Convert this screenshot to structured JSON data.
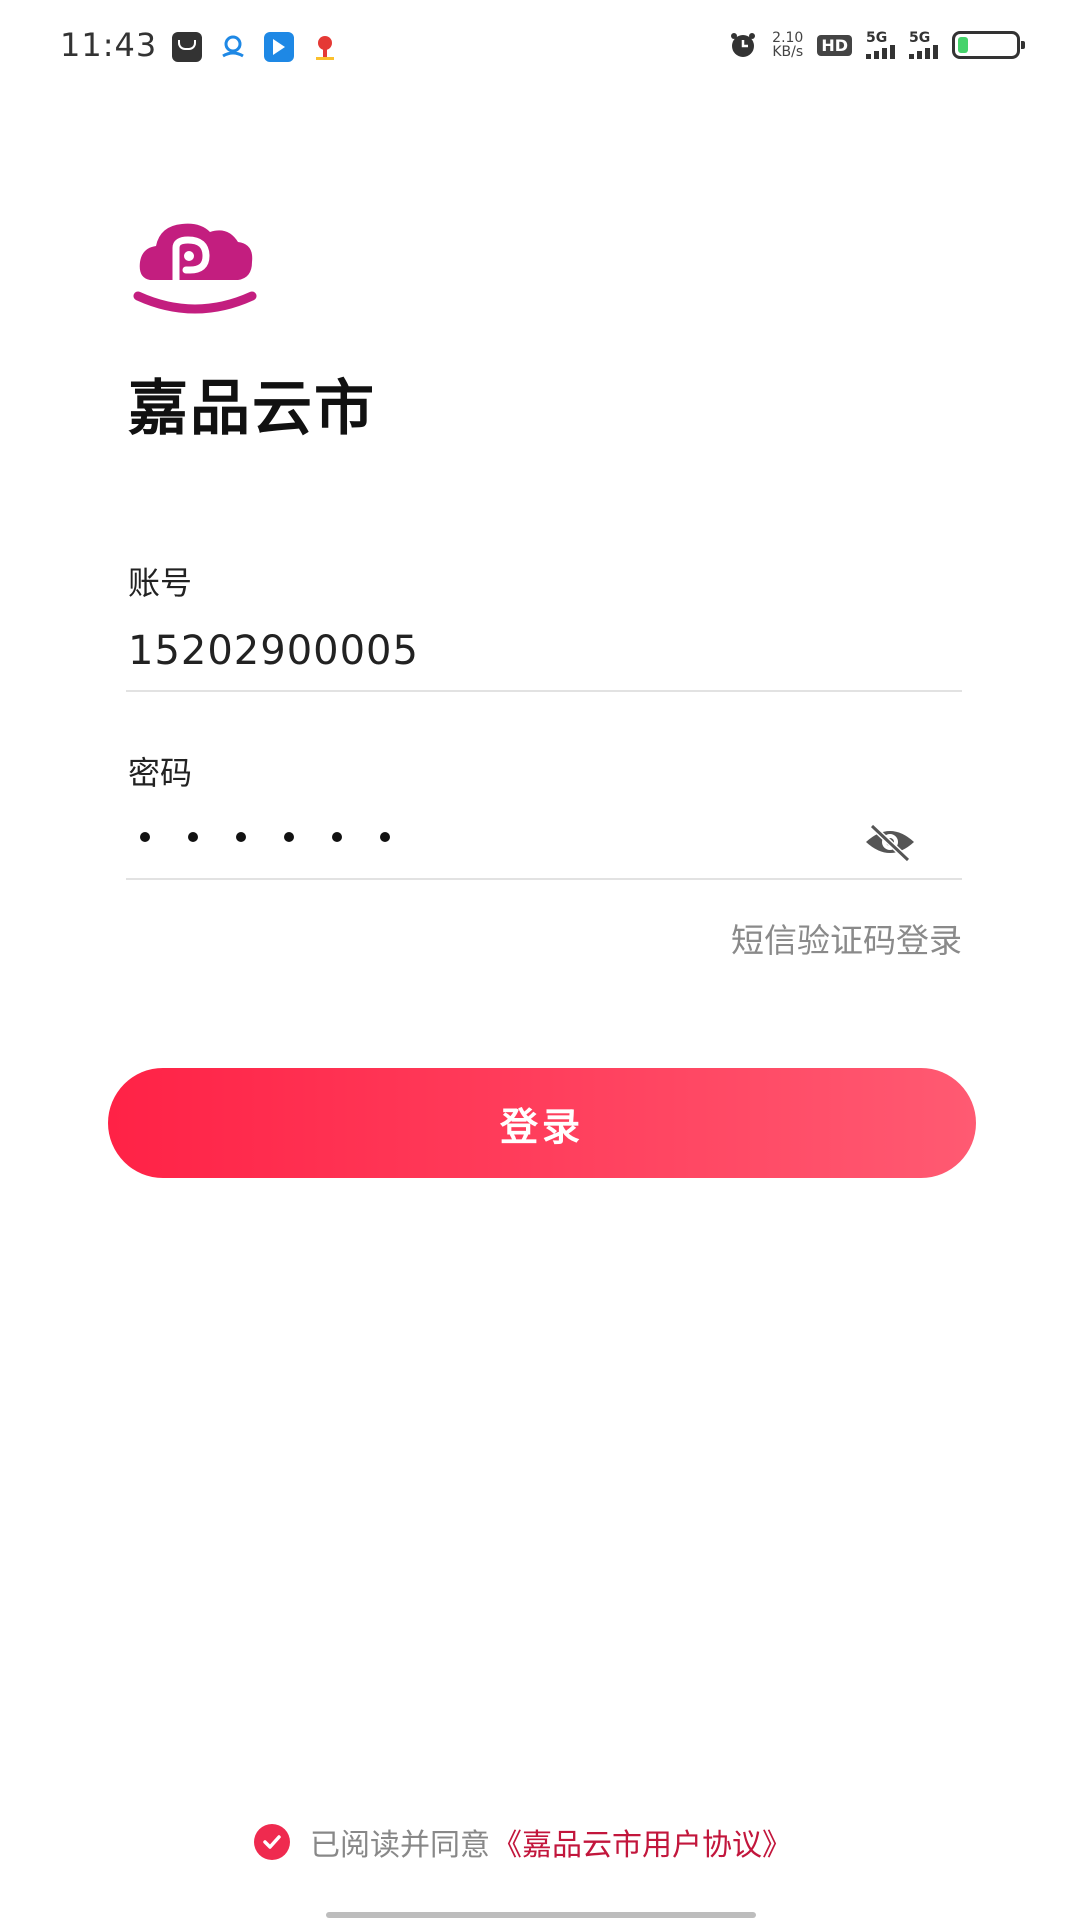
{
  "status_bar": {
    "time": "11:43",
    "net_speed_value": "2.10",
    "net_speed_unit": "KB/s",
    "hd_label": "HD",
    "sim1_label": "5G",
    "sim2_label": "5G",
    "battery_level": 0.18,
    "battery_color": "#45d36b"
  },
  "app": {
    "title": "嘉品云市",
    "logo_color": "#c31e7f"
  },
  "form": {
    "account_label": "账号",
    "account_value": "15202900005",
    "password_label": "密码",
    "password_mask_count": 6,
    "sms_login_label": "短信验证码登录",
    "login_button_label": "登录"
  },
  "agreement": {
    "prefix": "已阅读并同意",
    "link": "《嘉品云市用户协议》",
    "checked": true
  },
  "colors": {
    "accent_start": "#ff2246",
    "accent_end": "#ff5a72",
    "link": "#c2163c",
    "muted": "#8a8a8a"
  }
}
